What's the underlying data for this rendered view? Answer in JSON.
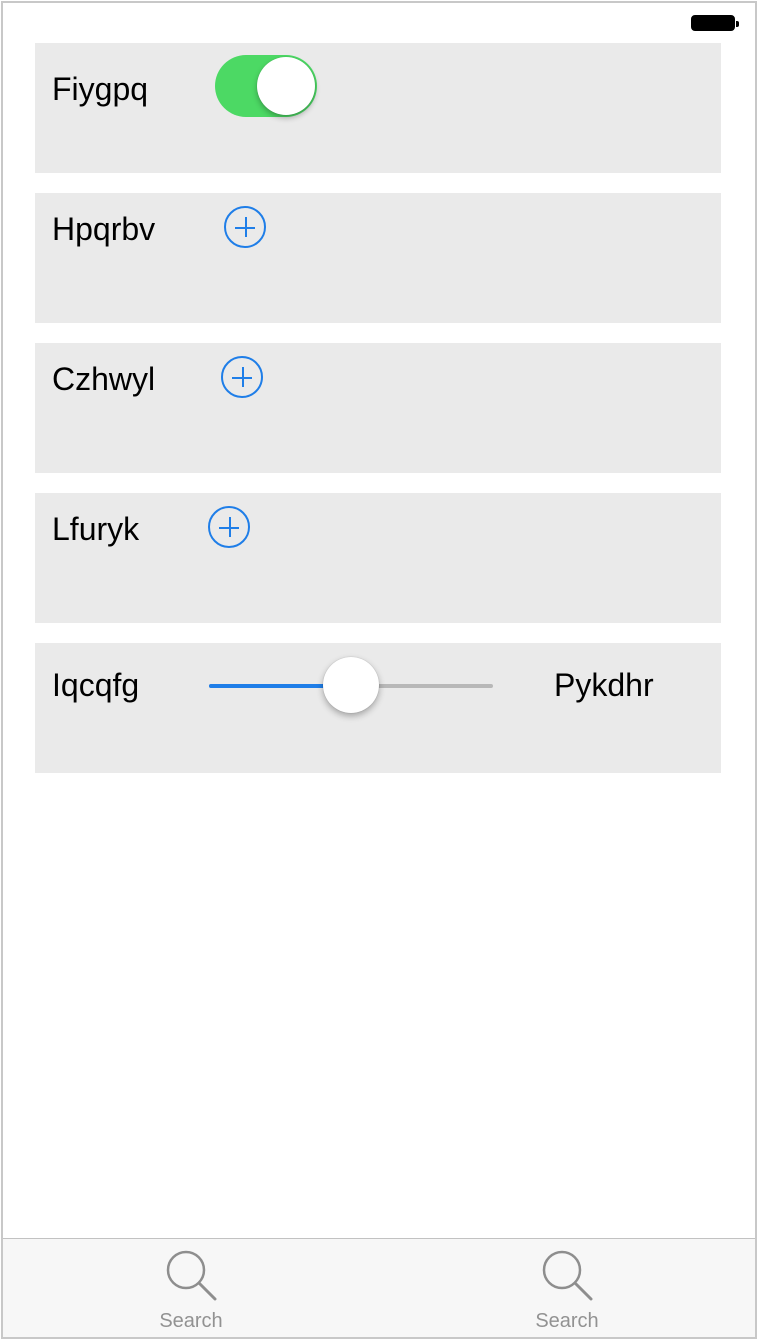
{
  "rows": [
    {
      "label": "Fiygpq",
      "control": "toggle",
      "on": true
    },
    {
      "label": "Hpqrbv",
      "control": "add-button"
    },
    {
      "label": "Czhwyl",
      "control": "add-button"
    },
    {
      "label": "Lfuryk",
      "control": "add-button"
    },
    {
      "label": "Iqcqfg",
      "control": "slider",
      "value": 0.5,
      "right_label": "Pykdhr"
    }
  ],
  "tab_bar": {
    "tabs": [
      {
        "label": "Search",
        "icon": "search-icon"
      },
      {
        "label": "Search",
        "icon": "search-icon"
      }
    ]
  },
  "colors": {
    "toggle_on": "#4cd964",
    "accent": "#1f7ee8",
    "row_background": "#eaeaea",
    "tab_label": "#929292"
  }
}
